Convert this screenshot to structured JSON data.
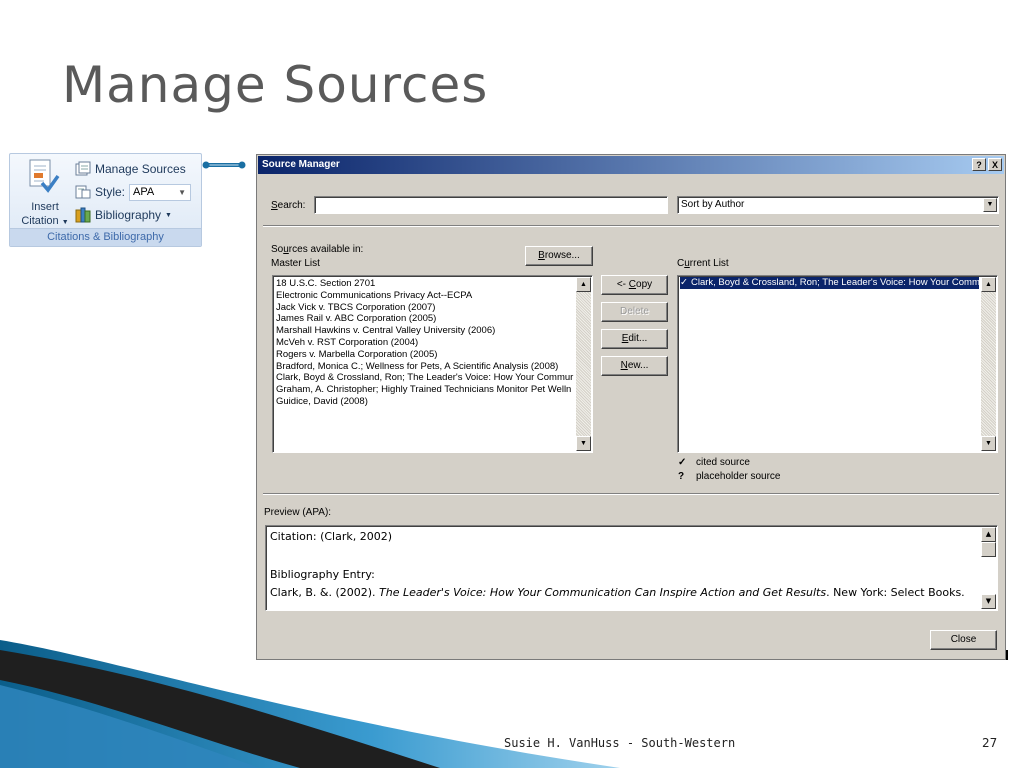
{
  "slide": {
    "title": "Manage Sources",
    "footer": "Susie H. VanHuss - South-Western",
    "page_number": "27"
  },
  "ribbon": {
    "insert_citation_line1": "Insert",
    "insert_citation_line2": "Citation",
    "manage_sources": "Manage Sources",
    "style_label": "Style:",
    "style_value": "APA",
    "bibliography": "Bibliography",
    "group_label": "Citations & Bibliography"
  },
  "dialog": {
    "title": "Source Manager",
    "help_btn": "?",
    "close_btn": "X",
    "search_label": "Search:",
    "search_value": "",
    "sort_value": "Sort by Author",
    "sources_available_label": "Sources available in:",
    "master_list_label": "Master List",
    "browse_btn": "Browse...",
    "current_list_label": "Current List",
    "master_list": [
      "18 U.S.C. Section 2701",
      "Electronic Communications Privacy Act--ECPA",
      "Jack Vick v. TBCS Corporation (2007)",
      "James Rail v. ABC Corporation (2005)",
      "Marshall Hawkins v. Central Valley University (2006)",
      "McVeh v. RST Corporation (2004)",
      "Rogers v. Marbella Corporation (2005)",
      "Bradford, Monica C.; Wellness for Pets, A Scientific Analysis (2008)",
      "Clark, Boyd & Crossland, Ron; The Leader's Voice:  How Your Commur",
      "Graham, A. Christopher; Highly Trained Technicians Monitor Pet Welln",
      "Guidice, David (2008)"
    ],
    "current_list": [
      "Clark, Boyd & Crossland, Ron; The Leader's Voice:  How Your Comm"
    ],
    "copy_btn": "<- Copy",
    "delete_btn": "Delete",
    "edit_btn": "Edit...",
    "new_btn": "New...",
    "legend_cited_symbol": "✓",
    "legend_cited": "cited source",
    "legend_placeholder_symbol": "?",
    "legend_placeholder": "placeholder source",
    "preview_label": "Preview (APA):",
    "preview_citation": "Citation: (Clark, 2002)",
    "preview_bib_heading": "Bibliography Entry:",
    "preview_bib_prefix": "Clark, B. &. (2002). ",
    "preview_bib_title": "The Leader's Voice: How Your Communication Can Inspire Action and Get Results",
    "preview_bib_suffix": ". New York: Select Books.",
    "close_button": "Close"
  },
  "colors": {
    "title_bar_start": "#0a246a",
    "title_bar_end": "#a6caf0",
    "dialog_face": "#d4d0c8",
    "ribbon_text": "#1e395b"
  }
}
